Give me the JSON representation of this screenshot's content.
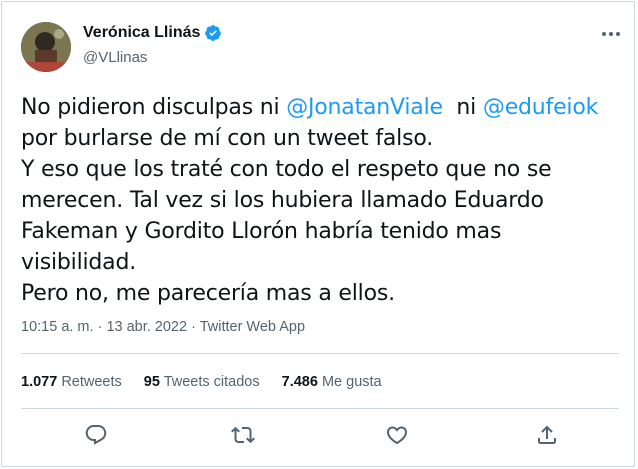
{
  "author": {
    "display_name": "Verónica Llinás",
    "handle": "@VLlinas",
    "verified": true
  },
  "tweet": {
    "line1_prefix": "No pidieron disculpas ni ",
    "mention1": "@JonatanViale",
    "line1_middle": "  ni ",
    "mention2": "@edufeiok",
    "line2": "por burlarse de mí con un tweet falso.",
    "line3": "Y eso que los traté con todo el respeto que no se merecen. Tal vez si los hubiera llamado Eduardo Fakeman y Gordito Llorón habría tenido mas visibilidad.",
    "line4": "Pero no, me parecería mas a ellos."
  },
  "meta": {
    "time": "10:15 a. m.",
    "separator1": " · ",
    "date": "13 abr. 2022",
    "separator2": " · ",
    "source": "Twitter Web App"
  },
  "stats": {
    "retweets_count": "1.077",
    "retweets_label": "Retweets",
    "quotes_count": "95",
    "quotes_label": "Tweets citados",
    "likes_count": "7.486",
    "likes_label": "Me gusta"
  },
  "actions": {
    "reply": "reply-icon",
    "retweet": "retweet-icon",
    "like": "heart-icon",
    "share": "share-icon"
  },
  "colors": {
    "accent": "#1d9bf0",
    "text": "#0f1419",
    "secondary": "#536471",
    "border": "#cfd9de"
  }
}
